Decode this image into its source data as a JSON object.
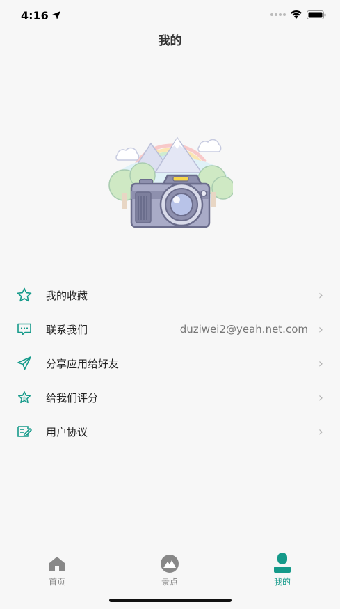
{
  "status": {
    "time": "4:16"
  },
  "nav": {
    "title": "我的"
  },
  "menu": {
    "items": [
      {
        "label": "我的收藏",
        "value": "",
        "icon": "star-icon"
      },
      {
        "label": "联系我们",
        "value": "duziwei2@yeah.net.com",
        "icon": "message-icon"
      },
      {
        "label": "分享应用给好友",
        "value": "",
        "icon": "send-icon"
      },
      {
        "label": "给我们评分",
        "value": "",
        "icon": "rate-star-icon"
      },
      {
        "label": "用户协议",
        "value": "",
        "icon": "agreement-icon"
      }
    ],
    "chevron": "›"
  },
  "tabbar": {
    "tabs": [
      {
        "label": "首页",
        "icon": "home-icon",
        "active": false
      },
      {
        "label": "景点",
        "icon": "mountain-icon",
        "active": false
      },
      {
        "label": "我的",
        "icon": "person-icon",
        "active": true
      }
    ]
  },
  "colors": {
    "accent": "#159a8a",
    "inactive": "#888888",
    "chevron": "#b3b3b3"
  }
}
